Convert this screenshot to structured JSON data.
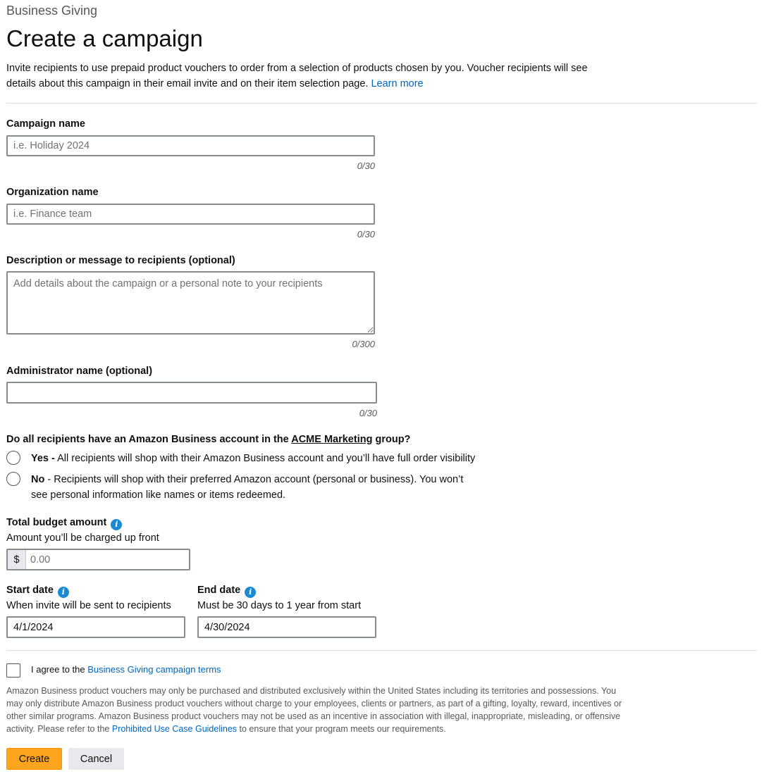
{
  "header": {
    "eyebrow": "Business Giving",
    "title": "Create a campaign",
    "intro_text": "Invite recipients to use prepaid product vouchers to order from a selection of products chosen by you. Voucher recipients will see details about this campaign in their email invite and on their item selection page.",
    "learn_more_link": "Learn more"
  },
  "campaign_name": {
    "label": "Campaign name",
    "placeholder": "i.e. Holiday 2024",
    "value": "",
    "counter": "0/30"
  },
  "organization_name": {
    "label": "Organization name",
    "placeholder": "i.e. Finance team",
    "value": "",
    "counter": "0/30"
  },
  "description": {
    "label": "Description or message to recipients (optional)",
    "placeholder": "Add details about the campaign or a personal note to your recipients",
    "value": "",
    "counter": "0/300"
  },
  "administrator_name": {
    "label": "Administrator name (optional)",
    "placeholder": "",
    "value": "",
    "counter": "0/30"
  },
  "account_question": {
    "prefix": "Do all recipients have an Amazon Business account in the",
    "group_link": "ACME Marketing",
    "suffix": "group?",
    "options": [
      {
        "bold": "Yes -",
        "text": "All recipients will shop with their Amazon Business account and you’ll have full order visibility"
      },
      {
        "bold": "No",
        "text": "- Recipients will shop with their preferred Amazon account (personal or business). You won’t see personal information like names or items redeemed."
      }
    ]
  },
  "budget": {
    "label": "Total budget amount",
    "sublabel": "Amount you’ll be charged up front",
    "currency": "$",
    "placeholder": "0.00",
    "value": ""
  },
  "start_date": {
    "label": "Start date",
    "sublabel": "When invite will be sent to recipients",
    "value": "4/1/2024"
  },
  "end_date": {
    "label": "End date",
    "sublabel": "Must be 30 days to 1 year from start",
    "value": "4/30/2024"
  },
  "terms": {
    "agree_text": "I agree to the",
    "terms_link": "Business Giving campaign terms",
    "checked": false
  },
  "disclaimer": {
    "text": "Amazon Business product vouchers may only be purchased and distributed exclusively within the United States including its territories and possessions. You may only distribute Amazon Business product vouchers without charge to your employees, clients or partners, as part of a gifting, loyalty, reward, incentives or other similar programs. Amazon Business product vouchers may not be used as an incentive in association with illegal, inappropriate, misleading, or offensive activity. Please refer to the",
    "link": "Prohibited Use Case Guidelines",
    "tail": "to ensure that your program meets our requirements."
  },
  "actions": {
    "create_label": "Create",
    "cancel_label": "Cancel"
  },
  "colors": {
    "primary_button": "#ffa41c",
    "link": "#0066c0",
    "info_icon": "#1a8ad4"
  },
  "icons": {
    "info": "info-icon",
    "resize": "resize-handle-icon"
  }
}
